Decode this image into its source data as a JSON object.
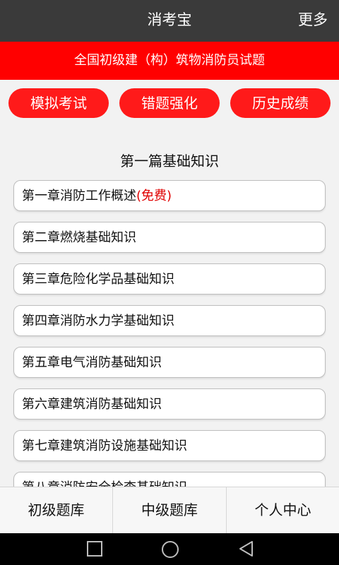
{
  "header": {
    "title": "消考宝",
    "more_label": "更多"
  },
  "subtitle": "全国初级建（构）筑物消防员试题",
  "actions": [
    {
      "label": "模拟考试"
    },
    {
      "label": "错题强化"
    },
    {
      "label": "历史成绩"
    }
  ],
  "section": {
    "title": "第一篇基础知识"
  },
  "chapters": [
    {
      "label": "第一章消防工作概述",
      "tag": "(免费)"
    },
    {
      "label": "第二章燃烧基础知识"
    },
    {
      "label": "第三章危险化学品基础知识"
    },
    {
      "label": "第四章消防水力学基础知识"
    },
    {
      "label": "第五章电气消防基础知识"
    },
    {
      "label": "第六章建筑消防基础知识"
    },
    {
      "label": "第七章建筑消防设施基础知识"
    },
    {
      "label": "第八章消防安全检查基础知识"
    }
  ],
  "tabs": [
    {
      "label": "初级题库"
    },
    {
      "label": "中级题库"
    },
    {
      "label": "个人中心"
    }
  ],
  "navbar": {
    "icons": [
      "recent-apps-icon",
      "home-icon",
      "back-icon"
    ]
  },
  "colors": {
    "accent": "#ff0000",
    "header_bg": "#3a3a3a",
    "free_tag": "#e00000"
  }
}
